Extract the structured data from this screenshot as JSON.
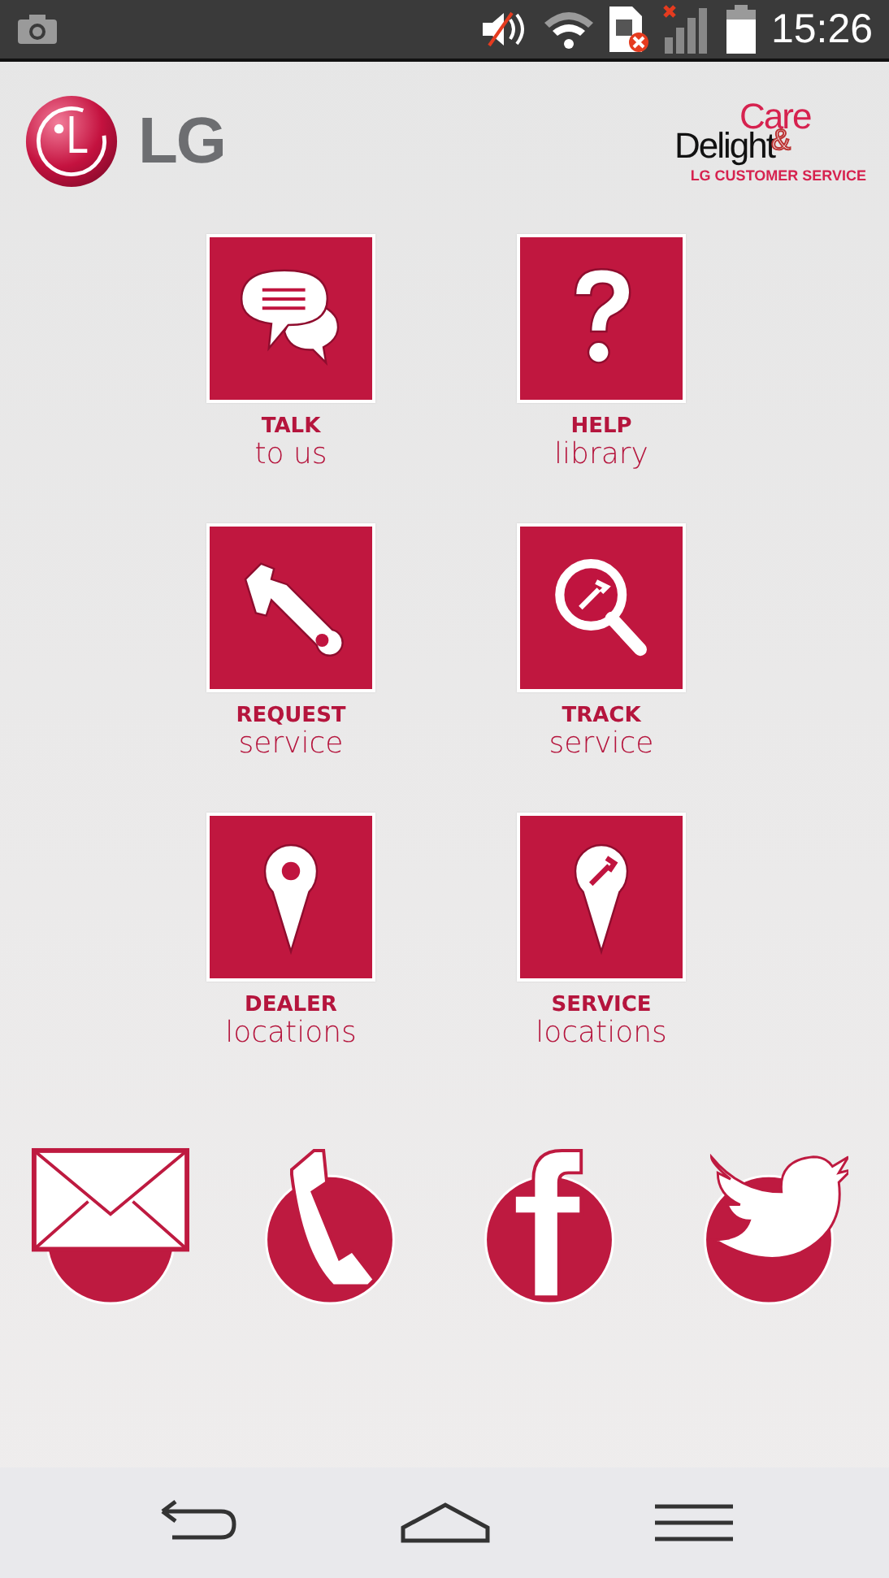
{
  "status_bar": {
    "time": "15:26"
  },
  "header": {
    "brand": "LG",
    "care": "Care",
    "amp": "&",
    "delight": "Delight",
    "service": "LG CUSTOMER SERVICE"
  },
  "tiles": [
    {
      "kind": "talk",
      "title": "TALK",
      "subtitle": "to us"
    },
    {
      "kind": "help",
      "title": "HELP",
      "subtitle": "library"
    },
    {
      "kind": "request",
      "title": "REQUEST",
      "subtitle": "service"
    },
    {
      "kind": "track",
      "title": "TRACK",
      "subtitle": "service"
    },
    {
      "kind": "dealer",
      "title": "DEALER",
      "subtitle": "locations"
    },
    {
      "kind": "servicepin",
      "title": "SERVICE",
      "subtitle": "locations"
    }
  ],
  "contacts": [
    {
      "kind": "mail"
    },
    {
      "kind": "phone"
    },
    {
      "kind": "facebook"
    },
    {
      "kind": "twitter"
    }
  ],
  "nav": [
    {
      "kind": "back"
    },
    {
      "kind": "home"
    },
    {
      "kind": "menu"
    }
  ]
}
